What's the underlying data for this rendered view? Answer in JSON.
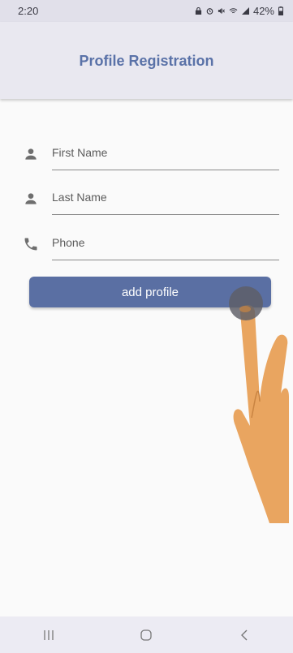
{
  "status_bar": {
    "time": "2:20",
    "battery_percent": "42%",
    "icons": [
      "lock-icon",
      "alarm-icon",
      "mute-icon",
      "wifi-icon",
      "signal-icon",
      "battery-icon"
    ]
  },
  "app_bar": {
    "title": "Profile Registration",
    "background": "#e9e8f0",
    "title_color": "#5a72a8"
  },
  "form": {
    "fields": [
      {
        "icon": "person-icon",
        "placeholder": "First Name"
      },
      {
        "icon": "person-icon",
        "placeholder": "Last Name"
      },
      {
        "icon": "phone-icon",
        "placeholder": "Phone"
      }
    ],
    "submit_label": "add profile",
    "accent": "#5a6fa3"
  },
  "nav_bar": {
    "buttons": [
      "recent-apps-icon",
      "home-icon",
      "back-icon"
    ]
  }
}
